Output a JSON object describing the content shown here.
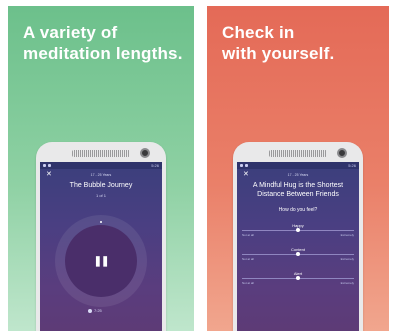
{
  "left_panel": {
    "headline_line1": "A variety of",
    "headline_line2": "meditation lengths.",
    "phone": {
      "status_time": "5:26",
      "close_glyph": "✕",
      "age_range": "17 - 25 Years",
      "title": "The Bubble Journey",
      "subtitle": "1 of 1",
      "pause_glyph": "❚❚",
      "duration": "7:25"
    }
  },
  "right_panel": {
    "headline_line1": "Check in",
    "headline_line2": "with yourself.",
    "phone": {
      "status_time": "5:26",
      "close_glyph": "✕",
      "age_range": "17 - 25 Years",
      "title": "A Mindful Hug is the Shortest Distance Between Friends",
      "question": "How do you feel?",
      "sliders": [
        {
          "label": "Happy",
          "left": "Not at all",
          "right": "Extremely",
          "value": 0.5
        },
        {
          "label": "Content",
          "left": "Not at all",
          "right": "Extremely",
          "value": 0.5
        },
        {
          "label": "Alert",
          "left": "Not at all",
          "right": "Extremely",
          "value": 0.5
        }
      ]
    }
  }
}
